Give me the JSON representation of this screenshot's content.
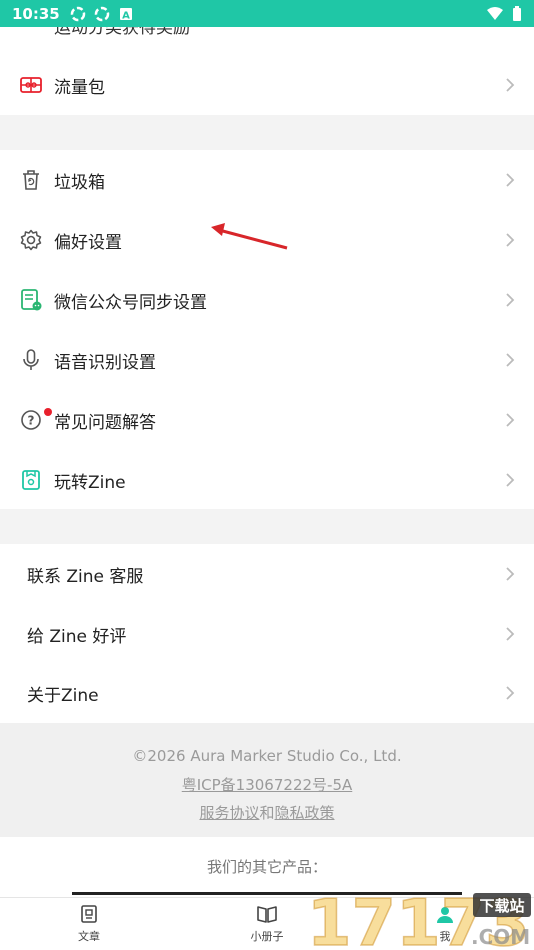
{
  "status": {
    "time": "10:35"
  },
  "top_cut_row": {
    "label": "运动分类获得奖励"
  },
  "section_a": {
    "items": [
      {
        "label": "流量包",
        "icon": "gift-card-icon"
      }
    ]
  },
  "section_b": {
    "items": [
      {
        "label": "垃圾箱",
        "icon": "trash-icon"
      },
      {
        "label": "偏好设置",
        "icon": "gear-icon"
      },
      {
        "label": "微信公众号同步设置",
        "icon": "wechat-doc-icon"
      },
      {
        "label": "语音识别设置",
        "icon": "microphone-icon"
      },
      {
        "label": "常见问题解答",
        "icon": "help-icon"
      },
      {
        "label": "玩转Zine",
        "icon": "book-icon"
      }
    ]
  },
  "section_c": {
    "items": [
      {
        "label": "联系 Zine 客服"
      },
      {
        "label": "给 Zine 好评"
      },
      {
        "label": "关于Zine"
      }
    ]
  },
  "footer": {
    "copyright": "©2026 Aura Marker Studio Co., Ltd.",
    "icp": "粤ICP备13067222号-5A",
    "policy_a": "服务协议",
    "policy_and": "和",
    "policy_b": "隐私政策"
  },
  "other_products": {
    "title": "我们的其它产品："
  },
  "tabbar": {
    "tabs": [
      {
        "label": "文章"
      },
      {
        "label": "小册子"
      },
      {
        "label": "我"
      }
    ]
  },
  "watermark": {
    "text": "17173",
    "badge": "下载站",
    "domain": ".COM"
  },
  "colors": {
    "status_bar": "#1fc7a6",
    "accent_red": "#e8202c",
    "text": "#222222",
    "muted": "#9a9a9a"
  }
}
